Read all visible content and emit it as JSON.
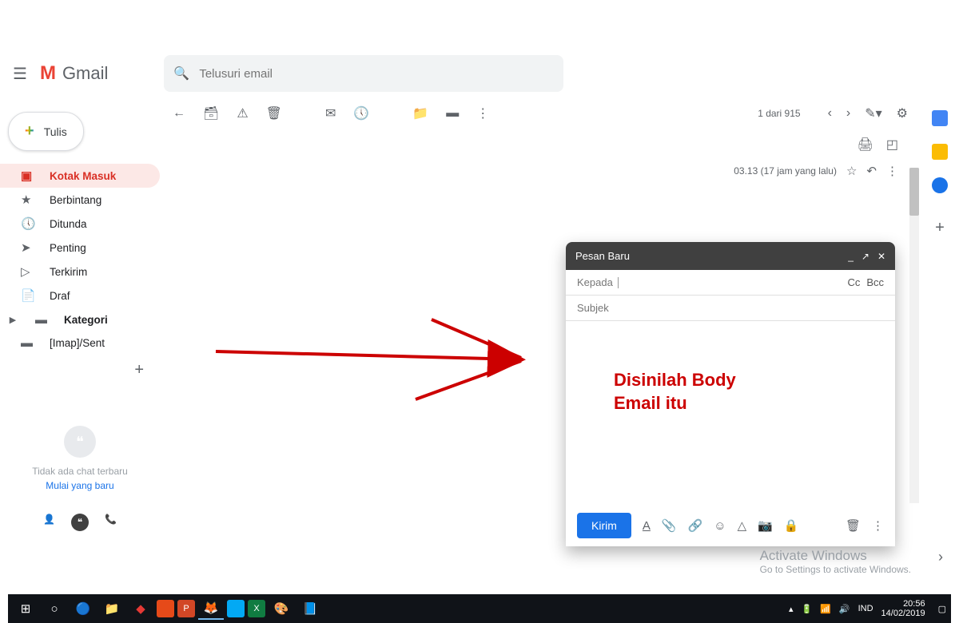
{
  "header": {
    "app_name": "Gmail",
    "search_placeholder": "Telusuri email"
  },
  "compose_btn": "Tulis",
  "sidebar": {
    "items": [
      {
        "icon": "inbox",
        "label": "Kotak Masuk",
        "active": true
      },
      {
        "icon": "star",
        "label": "Berbintang"
      },
      {
        "icon": "clock",
        "label": "Ditunda"
      },
      {
        "icon": "important",
        "label": "Penting"
      },
      {
        "icon": "sent",
        "label": "Terkirim"
      },
      {
        "icon": "draft",
        "label": "Draf"
      },
      {
        "icon": "category",
        "label": "Kategori",
        "bold": true,
        "expand": true
      },
      {
        "icon": "label",
        "label": "[Imap]/Sent"
      }
    ]
  },
  "hangouts": {
    "empty": "Tidak ada chat terbaru",
    "new": "Mulai yang baru"
  },
  "toolbar": {
    "count": "1 dari 915"
  },
  "message": {
    "time": "03.13 (17 jam yang lalu)"
  },
  "compose": {
    "title": "Pesan Baru",
    "to_label": "Kepada",
    "cc": "Cc",
    "bcc": "Bcc",
    "subject_placeholder": "Subjek",
    "send": "Kirim",
    "body_annotation_line1": "Disinilah Body",
    "body_annotation_line2": "Email itu"
  },
  "watermark": {
    "title": "Activate Windows",
    "sub": "Go to Settings to activate Windows."
  },
  "taskbar": {
    "lang": "IND",
    "time": "20:56",
    "date": "14/02/2019"
  }
}
